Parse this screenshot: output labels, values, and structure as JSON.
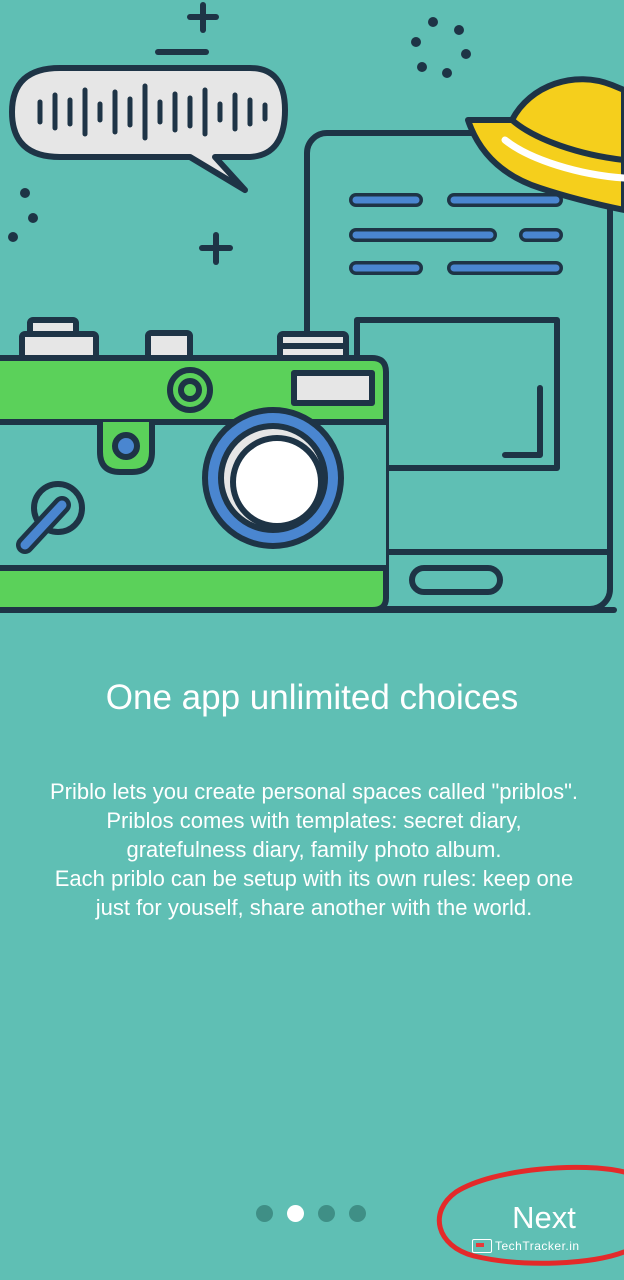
{
  "onboarding": {
    "title": "One app unlimited choices",
    "description_lines": [
      "Priblo lets you create personal spaces called \"priblos\".",
      "Priblos comes with templates: secret diary,",
      "gratefulness diary, family photo album.",
      "Each priblo can be setup with its own rules: keep one",
      "just for youself, share another with the world."
    ],
    "pagination": {
      "total": 4,
      "active_index": 1
    },
    "next_label": "Next"
  },
  "illustration": {
    "speech_bubble": "speech-bubble-icon",
    "camera": "camera-icon",
    "phone": "phone-icon",
    "hat": "bucket-hat-icon"
  },
  "watermark": {
    "text": "TechTracker.in"
  },
  "colors": {
    "background": "#5fbfb4",
    "camera_green": "#5bd15a",
    "outline": "#1e3446",
    "accent_blue": "#4a86d0",
    "hat_yellow": "#f5cf1c",
    "annotation_red": "#e42a2a"
  }
}
